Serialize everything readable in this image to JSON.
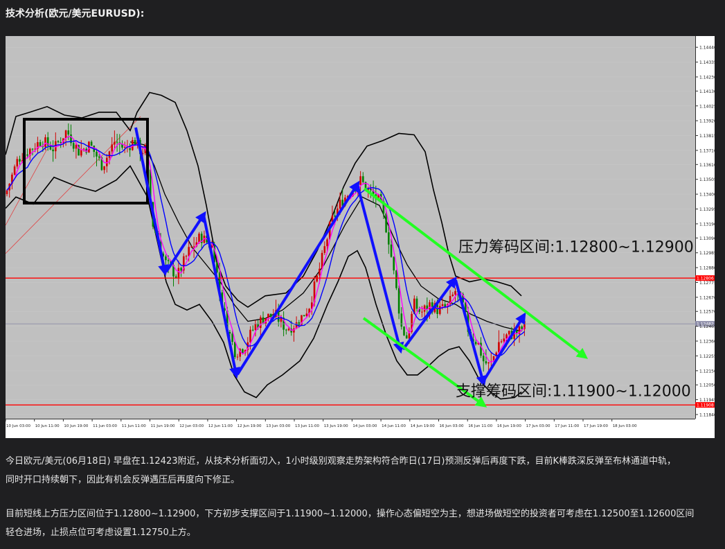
{
  "page": {
    "title": "技术分析(欧元/美元EURUSD):"
  },
  "paragraphs": [
    [
      "今日欧元/美元(06月18日) 早盘在1.12423附近，从技术分析面切入，1小时级别观察走势架构符合昨日(17日)预测反弹后再度下跌，目前K棒跌深反弹至布林通道中轨，",
      "同时开口持续朝下，因此有机会反弹遇压后再度向下修正。"
    ],
    [
      "目前短线上方压力区间位于1.12800~1.12900，下方初步支撑区间于1.11900~1.12000，操作心态偏短空为主，想进场做短空的投资者可考虑在1.12500至1.12600区间",
      "轻仓进场，止损点位可考虑设置1.12750上方。"
    ]
  ],
  "chart_data": {
    "type": "candlestick",
    "ylim": [
      1.1184,
      1.1449
    ],
    "yticks": [
      "1.14440",
      "1.14335",
      "1.14230",
      "1.14130",
      "1.14025",
      "1.13920",
      "1.13815",
      "1.13710",
      "1.13610",
      "1.13505",
      "1.13400",
      "1.13295",
      "1.13190",
      "1.13090",
      "1.12985",
      "1.12880",
      "1.12775",
      "1.12670",
      "1.12570",
      "1.12465",
      "1.12360",
      "1.12255",
      "1.12150",
      "1.12050",
      "1.11945",
      "1.11840"
    ],
    "xticks": [
      "10 Jun 03:00",
      "10 Jun 11:00",
      "10 Jun 19:00",
      "11 Jun 03:00",
      "11 Jun 11:00",
      "11 Jun 19:00",
      "12 Jun 03:00",
      "12 Jun 11:00",
      "12 Jun 19:00",
      "13 Jun 03:00",
      "13 Jun 11:00",
      "13 Jun 19:00",
      "14 Jun 03:00",
      "14 Jun 11:00",
      "14 Jun 19:00",
      "16 Jun 03:00",
      "16 Jun 11:00",
      "16 Jun 19:00",
      "17 Jun 03:00",
      "17 Jun 11:00",
      "17 Jun 19:00",
      "18 Jun 03:00"
    ],
    "hlines": [
      {
        "value": 1.12806,
        "label": "1.12806",
        "color": "#ff0000"
      },
      {
        "value": 1.11908,
        "label": "1.11908",
        "color": "#ff0000"
      },
      {
        "value": 1.12482,
        "label": "1.12482",
        "color": "#8c8ca8"
      }
    ],
    "annotations": [
      {
        "text": "压力筹码区间:1.12800~1.12900",
        "value": 1.1299
      },
      {
        "text": "支撑筹码区间:1.11900~1.12000",
        "value": 1.1197
      }
    ],
    "price_pivots": [
      [
        0,
        1.134
      ],
      [
        18,
        1.1365
      ],
      [
        36,
        1.1372
      ],
      [
        52,
        1.1378
      ],
      [
        70,
        1.1372
      ],
      [
        88,
        1.1385
      ],
      [
        106,
        1.137
      ],
      [
        122,
        1.1375
      ],
      [
        140,
        1.136
      ],
      [
        158,
        1.1378
      ],
      [
        172,
        1.1372
      ],
      [
        186,
        1.1378
      ],
      [
        196,
        1.137
      ],
      [
        202,
        1.1372
      ],
      [
        212,
        1.132
      ],
      [
        230,
        1.1292
      ],
      [
        248,
        1.1282
      ],
      [
        265,
        1.13
      ],
      [
        282,
        1.131
      ],
      [
        300,
        1.1302
      ],
      [
        310,
        1.1268
      ],
      [
        322,
        1.1243
      ],
      [
        332,
        1.1228
      ],
      [
        345,
        1.1232
      ],
      [
        360,
        1.1247
      ],
      [
        375,
        1.1253
      ],
      [
        390,
        1.1254
      ],
      [
        405,
        1.1245
      ],
      [
        420,
        1.1248
      ],
      [
        438,
        1.126
      ],
      [
        455,
        1.129
      ],
      [
        470,
        1.132
      ],
      [
        485,
        1.1335
      ],
      [
        500,
        1.1343
      ],
      [
        512,
        1.135
      ],
      [
        525,
        1.1342
      ],
      [
        540,
        1.1335
      ],
      [
        552,
        1.1312
      ],
      [
        565,
        1.127
      ],
      [
        572,
        1.1245
      ],
      [
        580,
        1.1238
      ],
      [
        590,
        1.1262
      ],
      [
        600,
        1.1256
      ],
      [
        612,
        1.1262
      ],
      [
        625,
        1.1258
      ],
      [
        638,
        1.126
      ],
      [
        650,
        1.1272
      ],
      [
        660,
        1.1262
      ],
      [
        670,
        1.124
      ],
      [
        682,
        1.1235
      ],
      [
        690,
        1.1222
      ],
      [
        700,
        1.1218
      ],
      [
        712,
        1.1235
      ],
      [
        725,
        1.124
      ],
      [
        740,
        1.1242
      ],
      [
        752,
        1.1248
      ]
    ],
    "bollinger": {
      "upper": [
        [
          180,
          1.1385
        ],
        [
          190,
          1.1398
        ],
        [
          208,
          1.1412
        ],
        [
          225,
          1.141
        ],
        [
          245,
          1.1405
        ],
        [
          262,
          1.1385
        ],
        [
          278,
          1.136
        ],
        [
          290,
          1.1332
        ],
        [
          305,
          1.1292
        ],
        [
          318,
          1.1275
        ],
        [
          335,
          1.1265
        ],
        [
          350,
          1.126
        ],
        [
          375,
          1.1268
        ],
        [
          405,
          1.127
        ],
        [
          430,
          1.1282
        ],
        [
          450,
          1.13
        ],
        [
          470,
          1.1322
        ],
        [
          488,
          1.1345
        ],
        [
          505,
          1.1362
        ],
        [
          522,
          1.1374
        ],
        [
          545,
          1.1378
        ],
        [
          568,
          1.1383
        ],
        [
          590,
          1.1382
        ],
        [
          606,
          1.137
        ],
        [
          618,
          1.1343
        ],
        [
          630,
          1.132
        ],
        [
          640,
          1.1298
        ],
        [
          650,
          1.1282
        ],
        [
          670,
          1.1278
        ],
        [
          690,
          1.128
        ],
        [
          710,
          1.1278
        ],
        [
          730,
          1.1275
        ],
        [
          745,
          1.1268
        ]
      ],
      "middle": [
        [
          180,
          1.1377
        ],
        [
          200,
          1.1375
        ],
        [
          215,
          1.136
        ],
        [
          230,
          1.134
        ],
        [
          250,
          1.132
        ],
        [
          270,
          1.1302
        ],
        [
          290,
          1.129
        ],
        [
          310,
          1.1278
        ],
        [
          330,
          1.1262
        ],
        [
          350,
          1.125
        ],
        [
          375,
          1.1252
        ],
        [
          400,
          1.1258
        ],
        [
          430,
          1.127
        ],
        [
          460,
          1.129
        ],
        [
          490,
          1.1318
        ],
        [
          515,
          1.1338
        ],
        [
          540,
          1.1332
        ],
        [
          560,
          1.131
        ],
        [
          580,
          1.129
        ],
        [
          600,
          1.1275
        ],
        [
          625,
          1.1266
        ],
        [
          650,
          1.1262
        ],
        [
          672,
          1.1255
        ],
        [
          695,
          1.125
        ],
        [
          720,
          1.1246
        ],
        [
          745,
          1.1243
        ]
      ],
      "lower": [
        [
          180,
          1.136
        ],
        [
          205,
          1.1338
        ],
        [
          220,
          1.1305
        ],
        [
          232,
          1.1278
        ],
        [
          245,
          1.1262
        ],
        [
          262,
          1.1258
        ],
        [
          280,
          1.1262
        ],
        [
          298,
          1.125
        ],
        [
          315,
          1.1235
        ],
        [
          330,
          1.1212
        ],
        [
          345,
          1.12
        ],
        [
          362,
          1.1196
        ],
        [
          378,
          1.1205
        ],
        [
          400,
          1.1212
        ],
        [
          425,
          1.1222
        ],
        [
          445,
          1.1238
        ],
        [
          465,
          1.1262
        ],
        [
          480,
          1.1278
        ],
        [
          495,
          1.1296
        ],
        [
          508,
          1.13
        ],
        [
          520,
          1.1288
        ],
        [
          535,
          1.1262
        ],
        [
          550,
          1.124
        ],
        [
          565,
          1.1222
        ],
        [
          580,
          1.1212
        ],
        [
          595,
          1.1212
        ],
        [
          610,
          1.1218
        ],
        [
          625,
          1.1225
        ],
        [
          640,
          1.123
        ],
        [
          655,
          1.1232
        ],
        [
          670,
          1.1222
        ],
        [
          685,
          1.1208
        ],
        [
          700,
          1.12
        ],
        [
          715,
          1.1195
        ],
        [
          735,
          1.1196
        ],
        [
          745,
          1.12
        ]
      ]
    }
  }
}
